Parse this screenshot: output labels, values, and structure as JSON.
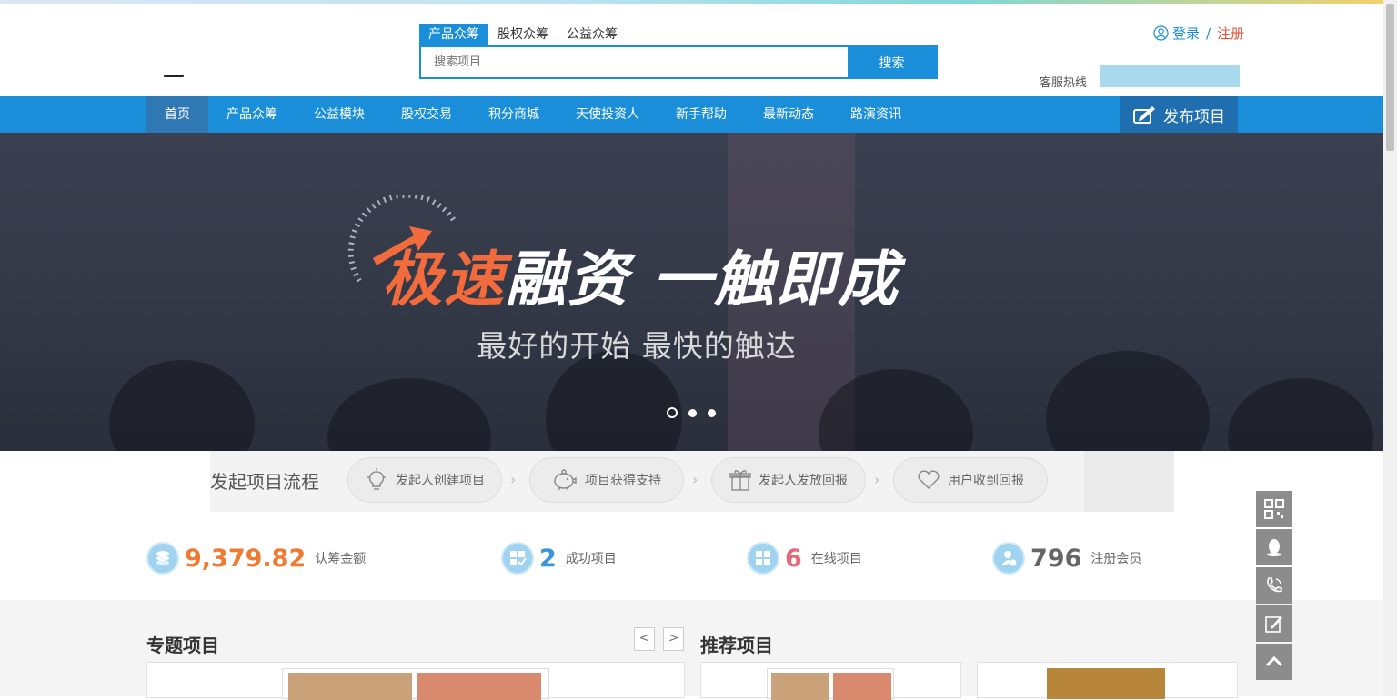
{
  "header": {
    "search_tabs": [
      "产品众筹",
      "股权众筹",
      "公益众筹"
    ],
    "search_placeholder": "搜索项目",
    "search_button": "搜索",
    "login": "登录",
    "separator": "/",
    "register": "注册",
    "hotline_label": "客服热线"
  },
  "nav": {
    "items": [
      "首页",
      "产品众筹",
      "公益模块",
      "股权交易",
      "积分商城",
      "天使投资人",
      "新手帮助",
      "最新动态",
      "路演资讯"
    ],
    "publish": "发布项目"
  },
  "banner": {
    "headline_orange": "极速",
    "headline_white": "融资 一触即成",
    "subline": "最好的开始 最快的触达",
    "slide_count": 3,
    "active_slide": 1
  },
  "process": {
    "title": "发起项目流程",
    "steps": [
      "发起人创建项目",
      "项目获得支持",
      "发起人发放回报",
      "用户收到回报"
    ]
  },
  "stats": [
    {
      "value": "9,379.82",
      "label": "认筹金额",
      "color": "#f07a32"
    },
    {
      "value": "2",
      "label": "成功项目",
      "color": "#3a96d6"
    },
    {
      "value": "6",
      "label": "在线项目",
      "color": "#e06a7a"
    },
    {
      "value": "796",
      "label": "注册会员",
      "color": "#666666"
    }
  ],
  "sections": {
    "special": "专题项目",
    "recommended": "推荐项目",
    "prev": "<",
    "next": ">"
  },
  "colors": {
    "primary": "#1a8ed9",
    "nav_active": "#2f78b4",
    "accent_orange": "#f26b3d",
    "register_red": "#e0523a"
  },
  "float_toolbar": [
    "qrcode-icon",
    "qq-icon",
    "phone-icon",
    "edit-icon",
    "back-to-top-icon"
  ]
}
